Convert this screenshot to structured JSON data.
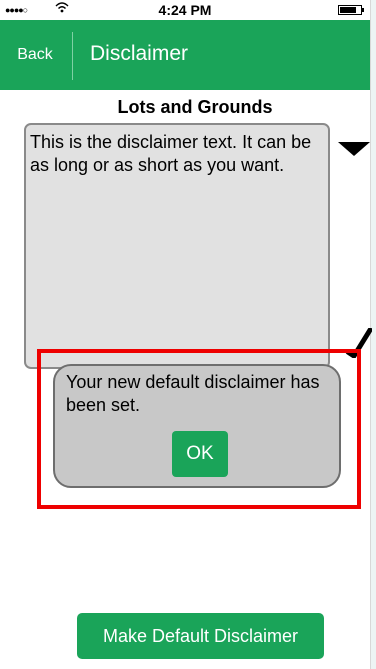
{
  "status_bar": {
    "signal": "●●●●○",
    "wifi_icon": "wifi-icon",
    "time": "4:24 PM",
    "battery_icon": "battery-icon"
  },
  "nav": {
    "back_label": "Back",
    "title": "Disclaimer",
    "color": "#1aa459"
  },
  "main": {
    "heading": "Lots and Grounds",
    "disclaimer_text": "This is the disclaimer text. It can be as long or as short as you want.",
    "dropdown_icon": "triangle-down-icon",
    "resize_icon": "checkmark-icon"
  },
  "alert": {
    "message": "Your new default disclaimer has been set.",
    "ok_label": "OK",
    "highlight_color": "#ee0000"
  },
  "footer": {
    "make_default_label": "Make Default Disclaimer"
  }
}
